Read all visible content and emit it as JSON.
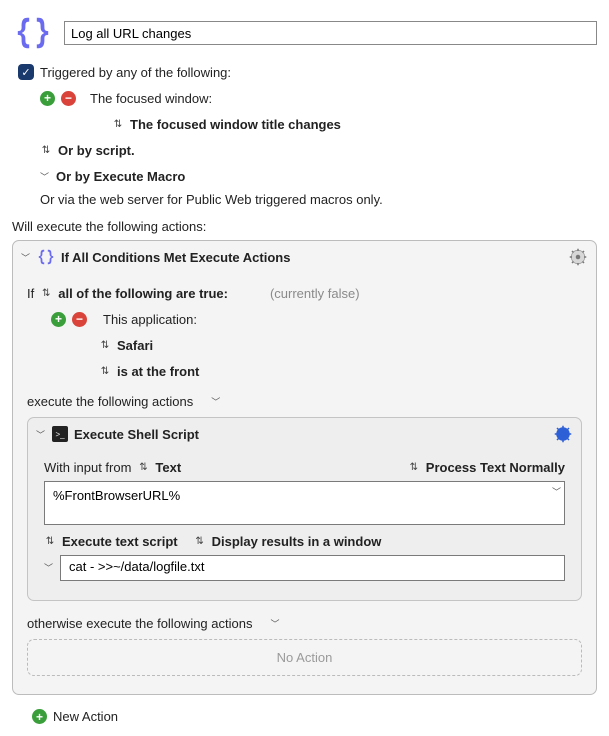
{
  "header": {
    "macro_title": "Log all URL changes"
  },
  "triggers": {
    "triggered_label": "Triggered by any of the following:",
    "focused_window_label": "The focused window:",
    "focused_window_event": "The focused window title changes",
    "by_script_label": "Or by script.",
    "by_execute_macro_label": "Or by Execute Macro",
    "via_web_label": "Or via the web server for Public Web triggered macros only."
  },
  "execute_label": "Will execute the following actions:",
  "if_block": {
    "title": "If All Conditions Met Execute Actions",
    "if_prefix": "If",
    "condition_scope": "all of the following are true:",
    "status": "(currently false)",
    "this_application_label": "This application:",
    "app_name": "Safari",
    "app_state": "is at the front",
    "execute_actions_label": "execute the following actions",
    "otherwise_label": "otherwise execute the following actions",
    "no_action_label": "No Action"
  },
  "shell": {
    "title": "Execute Shell Script",
    "with_input_prefix": "With input from",
    "input_mode": "Text",
    "process_mode": "Process Text Normally",
    "input_text": "%FrontBrowserURL%",
    "execute_text_script": "Execute text script",
    "display_mode": "Display results in a window",
    "script_text": "cat - >>~/data/logfile.txt"
  },
  "new_action_label": "New Action"
}
